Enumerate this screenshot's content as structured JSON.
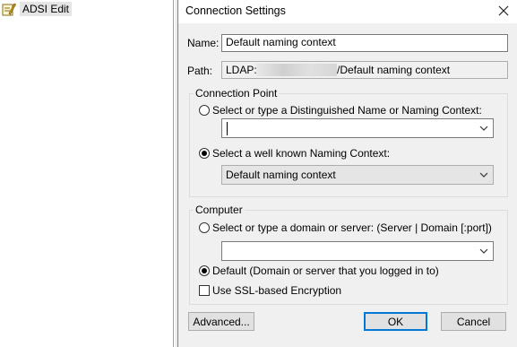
{
  "tree": {
    "root_label": "ADSI Edit"
  },
  "dialog": {
    "title": "Connection Settings",
    "name_label": "Name:",
    "name_value": "Default naming context",
    "path_label": "Path:",
    "path_prefix": "LDAP:/",
    "path_suffix": "/Default naming context",
    "connection_point": {
      "title": "Connection Point",
      "option_dn_label": "Select or type a Distinguished Name or Naming Context:",
      "option_dn_selected": false,
      "dn_value": "",
      "option_wellknown_label": "Select a well known Naming Context:",
      "option_wellknown_selected": true,
      "wellknown_value": "Default naming context"
    },
    "computer": {
      "title": "Computer",
      "option_server_label": "Select or type a domain or server: (Server | Domain [:port])",
      "option_server_selected": false,
      "server_value": "",
      "option_default_label": "Default (Domain or server that you logged in to)",
      "option_default_selected": true,
      "ssl_label": "Use SSL-based Encryption",
      "ssl_checked": false
    },
    "buttons": {
      "advanced": "Advanced...",
      "ok": "OK",
      "cancel": "Cancel"
    }
  },
  "icons": {
    "tree_icon": "adsi-edit-icon",
    "close": "close-icon",
    "dropdown": "chevron-down-icon"
  }
}
